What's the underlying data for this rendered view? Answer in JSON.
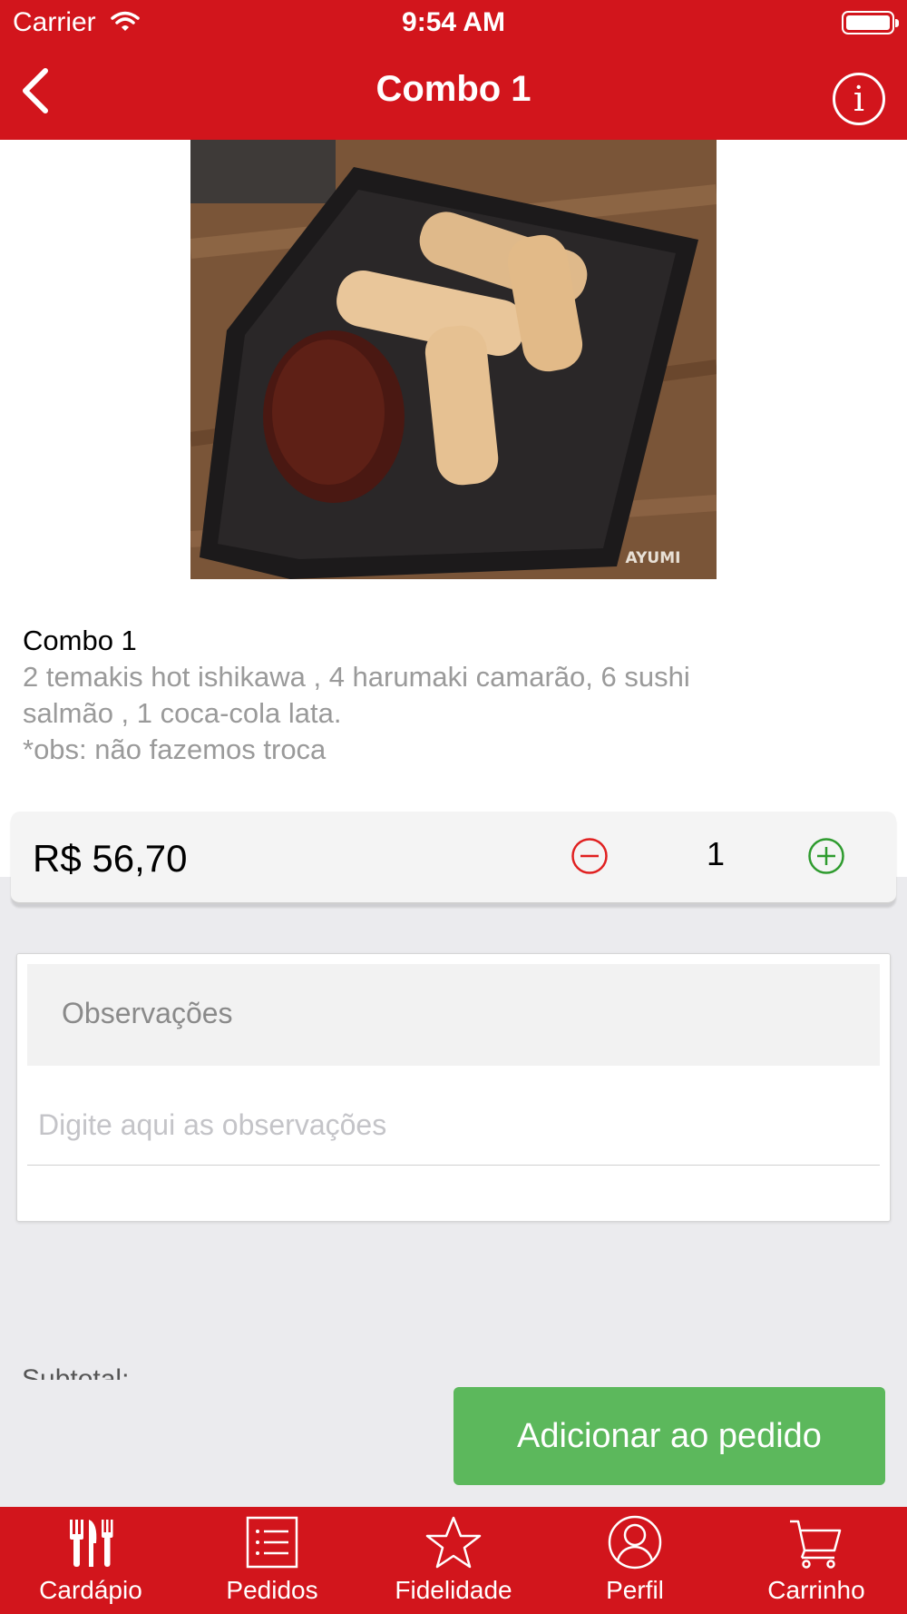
{
  "status_bar": {
    "carrier": "Carrier",
    "time": "9:54 AM"
  },
  "nav": {
    "title": "Combo 1",
    "back_icon": "chevron-left-icon",
    "info_icon": "info-icon",
    "info_glyph": "i"
  },
  "product": {
    "image_watermark": "AYUMI",
    "name": "Combo 1",
    "description_lines": [
      "2 temakis hot ishikawa , 4 harumaki camarão, 6 sushi",
      "salmão , 1 coca-cola lata.",
      "*obs: não fazemos troca"
    ],
    "price": "R$ 56,70",
    "quantity": "1"
  },
  "notes": {
    "header": "Observações",
    "placeholder": "Digite aqui as observações"
  },
  "footer": {
    "subtotal_label": "Subtotal:",
    "add_button": "Adicionar ao pedido"
  },
  "tabs": [
    {
      "label": "Cardápio",
      "icon": "fork-knife-icon"
    },
    {
      "label": "Pedidos",
      "icon": "list-icon"
    },
    {
      "label": "Fidelidade",
      "icon": "star-icon"
    },
    {
      "label": "Perfil",
      "icon": "profile-icon"
    },
    {
      "label": "Carrinho",
      "icon": "cart-icon"
    }
  ],
  "colors": {
    "brand_red": "#d2151c",
    "add_green": "#5cb85c",
    "minus_red": "#e02020",
    "plus_green": "#2e9b2e"
  }
}
